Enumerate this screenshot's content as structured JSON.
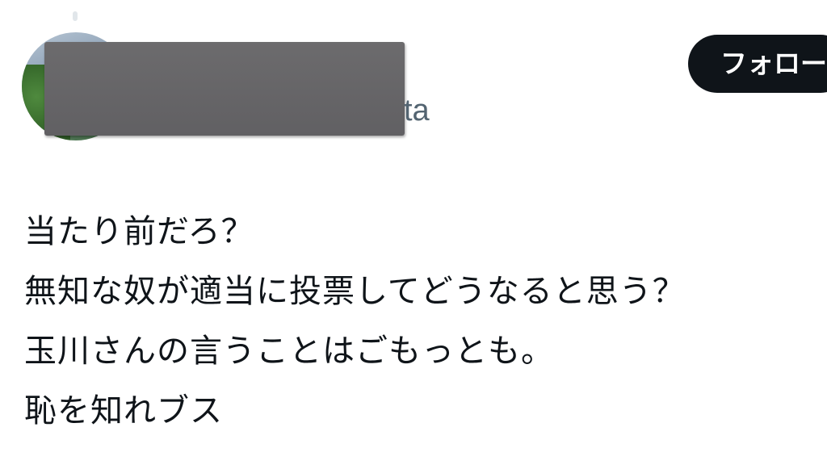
{
  "tweet": {
    "author": {
      "handle_visible": "ta",
      "follow_label": "フォロー"
    },
    "body_lines": [
      "当たり前だろ？",
      "無知な奴が適当に投票してどうなると思う？",
      "玉川さんの言うことはごもっとも。",
      "恥を知れブス"
    ]
  },
  "colors": {
    "text": "#0f1419",
    "secondary_text": "#536471",
    "follow_button_bg": "#0f1419",
    "redaction": "#666568"
  }
}
